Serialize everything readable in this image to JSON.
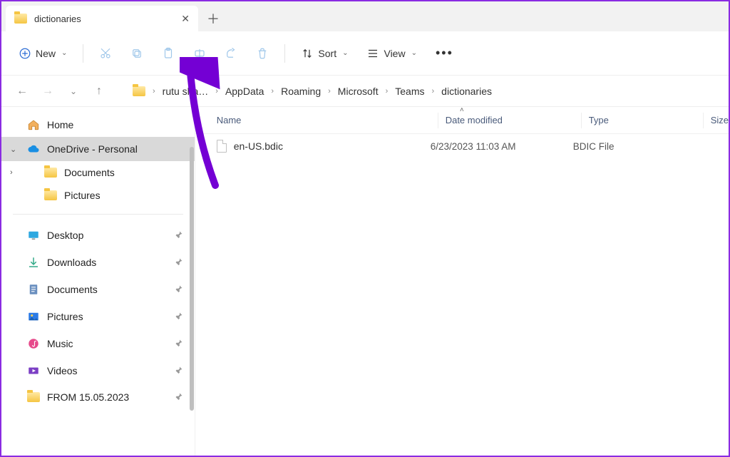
{
  "tab": {
    "title": "dictionaries"
  },
  "toolbar": {
    "new_label": "New",
    "sort_label": "Sort",
    "view_label": "View"
  },
  "breadcrumbs": [
    "rutu sha…",
    "AppData",
    "Roaming",
    "Microsoft",
    "Teams",
    "dictionaries"
  ],
  "sidebar": {
    "home": "Home",
    "onedrive": "OneDrive - Personal",
    "onedrive_children": [
      "Documents",
      "Pictures"
    ],
    "quick": [
      {
        "label": "Desktop",
        "icon": "desktop"
      },
      {
        "label": "Downloads",
        "icon": "downloads"
      },
      {
        "label": "Documents",
        "icon": "documents"
      },
      {
        "label": "Pictures",
        "icon": "pictures"
      },
      {
        "label": "Music",
        "icon": "music"
      },
      {
        "label": "Videos",
        "icon": "videos"
      },
      {
        "label": "FROM 15.05.2023",
        "icon": "folder"
      }
    ]
  },
  "columns": {
    "name": "Name",
    "date": "Date modified",
    "type": "Type",
    "size": "Size"
  },
  "rows": [
    {
      "name": "en-US.bdic",
      "date": "6/23/2023 11:03 AM",
      "type": "BDIC File"
    }
  ]
}
